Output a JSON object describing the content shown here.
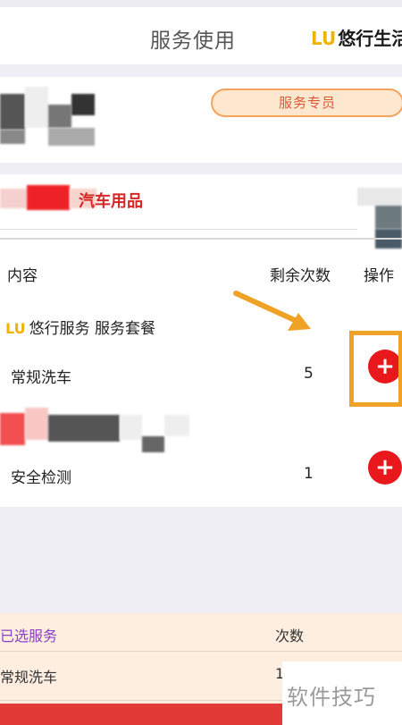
{
  "header": {
    "title": "服务使用",
    "brand_logo": "lu-logo",
    "brand_name": "悠行生活"
  },
  "profile": {
    "staff_button": "服务专员"
  },
  "shop": {
    "title": "汽车用品"
  },
  "table": {
    "col_content": "内容",
    "col_remaining": "剩余次数",
    "col_action": "操作"
  },
  "package": {
    "title": "悠行服务 服务套餐"
  },
  "services": [
    {
      "name": "常规洗车",
      "remaining": "5",
      "action": "+"
    },
    {
      "name": "安全检测",
      "remaining": "1",
      "action": "+"
    }
  ],
  "selected": {
    "label": "已选服务",
    "count_label": "次数",
    "items": [
      {
        "name": "常规洗车",
        "count": "1"
      }
    ]
  },
  "watermark": "软件技巧",
  "colors": {
    "accent_red": "#e8181d",
    "brand_gold": "#f0b400",
    "highlight_orange": "#f0a227",
    "purple_label": "#8a3fc4"
  }
}
